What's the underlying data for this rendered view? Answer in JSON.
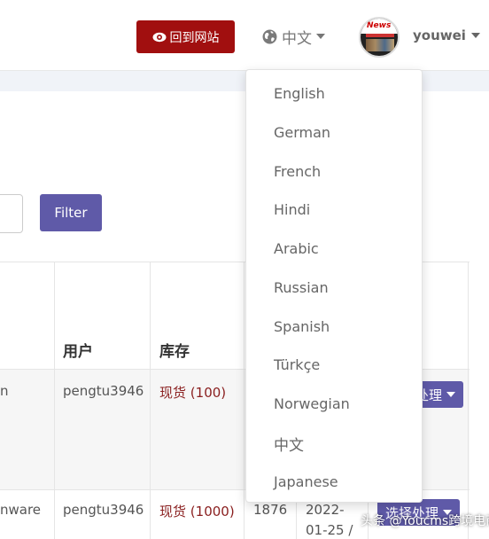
{
  "header": {
    "back_to_site": "回到网站",
    "language": "中文",
    "user": "youwei",
    "avatar_logo": "News"
  },
  "filter": {
    "button_label": "Filter"
  },
  "table": {
    "headers": {
      "user": "用户",
      "stock": "库存"
    },
    "rows": [
      {
        "name_fragment": "n",
        "user": "pengtu3946",
        "stock_label": "现货",
        "stock_qty": "(100)",
        "action": "选择处理"
      },
      {
        "name_fragment": "nware",
        "user": "pengtu3946",
        "stock_label": "现货",
        "stock_qty": "(1000)",
        "number": "1876",
        "date_line1": "2022-",
        "date_line2": "01-25 /",
        "action": "选择处理"
      }
    ]
  },
  "language_menu": {
    "items": [
      "English",
      "German",
      "French",
      "Hindi",
      "Arabic",
      "Russian",
      "Spanish",
      "Türkçe",
      "Norwegian",
      "中文",
      "Japanese"
    ]
  },
  "watermark": "头条 @Youcms跨境电商"
}
